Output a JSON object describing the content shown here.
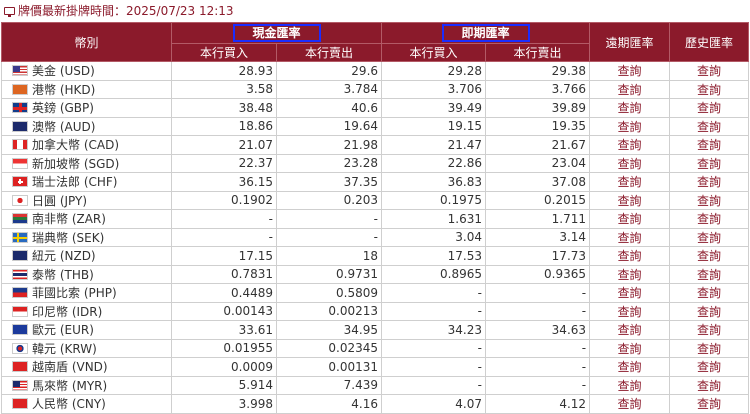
{
  "header": {
    "timestamp_label": "牌價最新掛牌時間：2025/07/23 12:13"
  },
  "table": {
    "col_currency": "幣別",
    "group_cash": "現金匯率",
    "group_spot": "即期匯率",
    "col_forward": "遠期匯率",
    "col_history": "歷史匯率",
    "sub_buy": "本行買入",
    "sub_sell": "本行賣出",
    "rows": [
      {
        "flag": "us-flag-icon",
        "cls": "usd",
        "name": "美金 (USD)",
        "cash_buy": "28.93",
        "cash_sell": "29.6",
        "spot_buy": "29.28",
        "spot_sell": "29.38",
        "forward": "查詢",
        "history": "查詢"
      },
      {
        "flag": "hk-flag-icon",
        "cls": "hkd",
        "name": "港幣 (HKD)",
        "cash_buy": "3.58",
        "cash_sell": "3.784",
        "spot_buy": "3.706",
        "spot_sell": "3.766",
        "forward": "查詢",
        "history": "查詢"
      },
      {
        "flag": "uk-flag-icon",
        "cls": "gbp",
        "name": "英鎊 (GBP)",
        "cash_buy": "38.48",
        "cash_sell": "40.6",
        "spot_buy": "39.49",
        "spot_sell": "39.89",
        "forward": "查詢",
        "history": "查詢"
      },
      {
        "flag": "au-flag-icon",
        "cls": "aud",
        "name": "澳幣 (AUD)",
        "cash_buy": "18.86",
        "cash_sell": "19.64",
        "spot_buy": "19.15",
        "spot_sell": "19.35",
        "forward": "查詢",
        "history": "查詢"
      },
      {
        "flag": "ca-flag-icon",
        "cls": "cad",
        "name": "加拿大幣 (CAD)",
        "cash_buy": "21.07",
        "cash_sell": "21.98",
        "spot_buy": "21.47",
        "spot_sell": "21.67",
        "forward": "查詢",
        "history": "查詢"
      },
      {
        "flag": "sg-flag-icon",
        "cls": "sgd",
        "name": "新加坡幣 (SGD)",
        "cash_buy": "22.37",
        "cash_sell": "23.28",
        "spot_buy": "22.86",
        "spot_sell": "23.04",
        "forward": "查詢",
        "history": "查詢"
      },
      {
        "flag": "ch-flag-icon",
        "cls": "chf",
        "name": "瑞士法郎 (CHF)",
        "cash_buy": "36.15",
        "cash_sell": "37.35",
        "spot_buy": "36.83",
        "spot_sell": "37.08",
        "forward": "查詢",
        "history": "查詢"
      },
      {
        "flag": "jp-flag-icon",
        "cls": "jpy",
        "name": "日圓 (JPY)",
        "cash_buy": "0.1902",
        "cash_sell": "0.203",
        "spot_buy": "0.1975",
        "spot_sell": "0.2015",
        "forward": "查詢",
        "history": "查詢"
      },
      {
        "flag": "za-flag-icon",
        "cls": "zar",
        "name": "南非幣 (ZAR)",
        "cash_buy": "-",
        "cash_sell": "-",
        "spot_buy": "1.631",
        "spot_sell": "1.711",
        "forward": "查詢",
        "history": "查詢"
      },
      {
        "flag": "se-flag-icon",
        "cls": "sek",
        "name": "瑞典幣 (SEK)",
        "cash_buy": "-",
        "cash_sell": "-",
        "spot_buy": "3.04",
        "spot_sell": "3.14",
        "forward": "查詢",
        "history": "查詢"
      },
      {
        "flag": "nz-flag-icon",
        "cls": "nzd",
        "name": "紐元 (NZD)",
        "cash_buy": "17.15",
        "cash_sell": "18",
        "spot_buy": "17.53",
        "spot_sell": "17.73",
        "forward": "查詢",
        "history": "查詢"
      },
      {
        "flag": "th-flag-icon",
        "cls": "thb",
        "name": "泰幣 (THB)",
        "cash_buy": "0.7831",
        "cash_sell": "0.9731",
        "spot_buy": "0.8965",
        "spot_sell": "0.9365",
        "forward": "查詢",
        "history": "查詢"
      },
      {
        "flag": "ph-flag-icon",
        "cls": "php",
        "name": "菲國比索 (PHP)",
        "cash_buy": "0.4489",
        "cash_sell": "0.5809",
        "spot_buy": "-",
        "spot_sell": "-",
        "forward": "查詢",
        "history": "查詢"
      },
      {
        "flag": "id-flag-icon",
        "cls": "idr",
        "name": "印尼幣 (IDR)",
        "cash_buy": "0.00143",
        "cash_sell": "0.00213",
        "spot_buy": "-",
        "spot_sell": "-",
        "forward": "查詢",
        "history": "查詢"
      },
      {
        "flag": "eu-flag-icon",
        "cls": "eur",
        "name": "歐元 (EUR)",
        "cash_buy": "33.61",
        "cash_sell": "34.95",
        "spot_buy": "34.23",
        "spot_sell": "34.63",
        "forward": "查詢",
        "history": "查詢"
      },
      {
        "flag": "kr-flag-icon",
        "cls": "krw",
        "name": "韓元 (KRW)",
        "cash_buy": "0.01955",
        "cash_sell": "0.02345",
        "spot_buy": "-",
        "spot_sell": "-",
        "forward": "查詢",
        "history": "查詢"
      },
      {
        "flag": "vn-flag-icon",
        "cls": "vnd",
        "name": "越南盾 (VND)",
        "cash_buy": "0.0009",
        "cash_sell": "0.00131",
        "spot_buy": "-",
        "spot_sell": "-",
        "forward": "查詢",
        "history": "查詢"
      },
      {
        "flag": "my-flag-icon",
        "cls": "myr",
        "name": "馬來幣 (MYR)",
        "cash_buy": "5.914",
        "cash_sell": "7.439",
        "spot_buy": "-",
        "spot_sell": "-",
        "forward": "查詢",
        "history": "查詢"
      },
      {
        "flag": "cn-flag-icon",
        "cls": "cny",
        "name": "人民幣 (CNY)",
        "cash_buy": "3.998",
        "cash_sell": "4.16",
        "spot_buy": "4.07",
        "spot_sell": "4.12",
        "forward": "查詢",
        "history": "查詢"
      }
    ]
  },
  "colors": {
    "header_bg": "#8b1a2b",
    "highlight_box": "#1a2cff",
    "link": "#8b1a2b"
  }
}
